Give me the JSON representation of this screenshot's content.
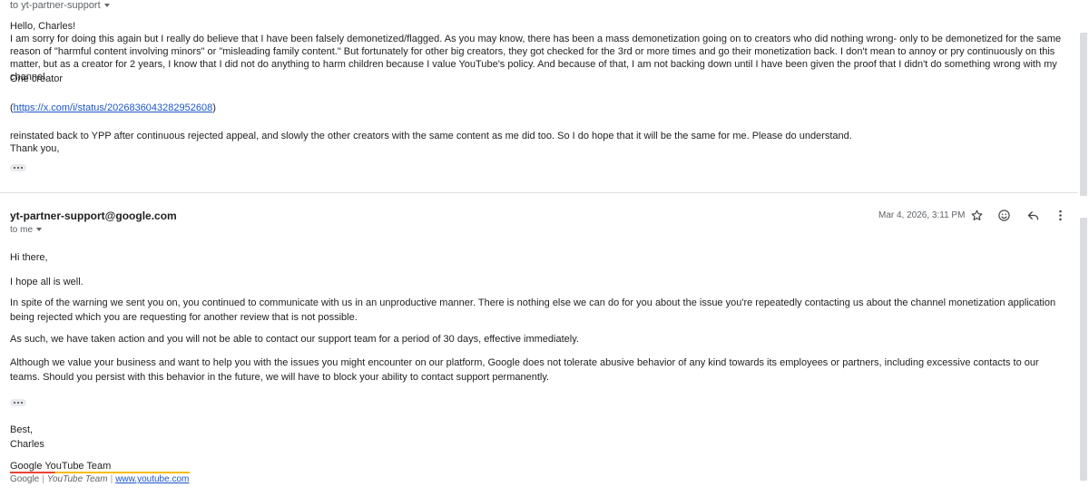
{
  "first_message": {
    "to_line": "to yt-partner-support",
    "greeting": "Hello, Charles!",
    "paragraph": "I am sorry for doing this again but I really do believe that I have been falsely demonetized/flagged. As you may know, there has been a mass demonetization going on to creators who did nothing wrong- only to be demonetized for the same reason of \"harmful content involving minors\" or \"misleading family content.\" But fortunately for other big creators, they got checked for the 3rd or more times and go their monetization back. I don't mean to annoy or pry continuously on this matter, but as a creator for 2 years, I know that I did not do anything to harm children because I value YouTube's policy. And because of that, I am not backing down until I have been given the proof that I didn't do something wrong with my channel.",
    "one_creator": "One creator",
    "link_open": "(",
    "link_text": "https://x.com/i/status/2026836043282952608",
    "link_close": ")",
    "reinstated": "reinstated back to YPP after continuous rejected appeal, and slowly the other creators with the same content as me did too. So I do hope that it will be the same for me. Please do understand.",
    "thank_you": "Thank you,"
  },
  "second_message": {
    "sender": "yt-partner-support@google.com",
    "to_me": "to me",
    "date": "Mar 4, 2026, 3:11 PM",
    "greeting": "Hi there,",
    "p1": "I hope all is well.",
    "p2": "In spite of the warning we sent you on, you continued to communicate with us in an unproductive manner. There is nothing else we can do for you about the issue you're repeatedly contacting us about the channel monetization application being rejected which you are requesting for another review that is not possible.",
    "p3": "As such, we have taken action and you will not be able to contact our support team for a period of 30 days, effective immediately.",
    "p4": "Although we value your business and want to help you with the issues you might encounter on our platform, Google does not tolerate abusive behavior of any kind towards its employees or partners, including excessive contacts to our teams. Should you persist with this behavior in the future, we will have to block your ability to contact support permanently.",
    "closing": "Best,",
    "name": "Charles",
    "team": "Google YouTube Team",
    "footer": {
      "google": "Google",
      "sep": "|",
      "youtube_team": "YouTube Team",
      "website": "www.youtube.com"
    }
  },
  "icons": {
    "star": "star-icon",
    "emoji": "emoji-icon",
    "reply": "reply-icon",
    "more": "more-vert-icon"
  },
  "colors": {
    "link": "#1a56c9",
    "signature_accent_red": "#ea4335",
    "signature_accent_yellow": "#fbbc04"
  }
}
